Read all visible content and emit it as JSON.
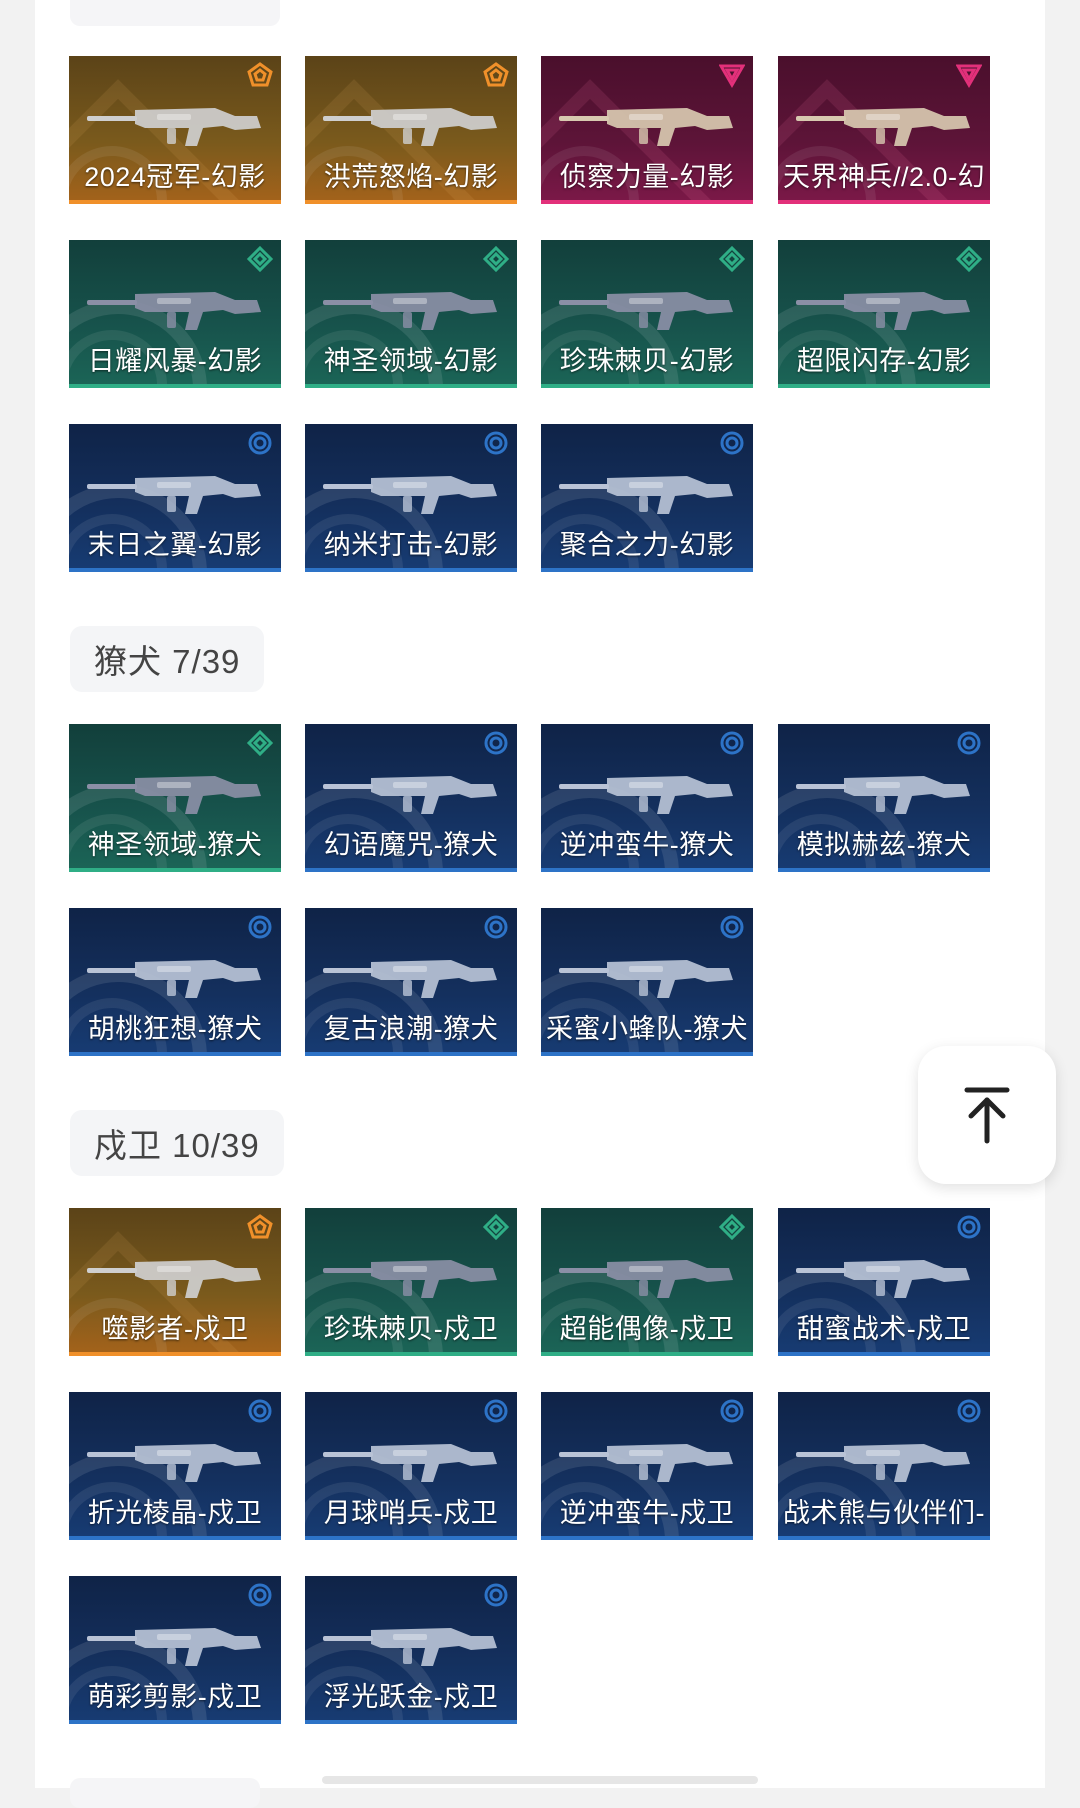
{
  "sections": [
    {
      "title": "",
      "tiles": [
        {
          "name": "2024冠军-幻影",
          "tier": "orange"
        },
        {
          "name": "洪荒怒焰-幻影",
          "tier": "orange"
        },
        {
          "name": "侦察力量-幻影",
          "tier": "pink"
        },
        {
          "name": "天界神兵//2.0-幻",
          "tier": "pink"
        },
        {
          "name": "日耀风暴-幻影",
          "tier": "green"
        },
        {
          "name": "神圣领域-幻影",
          "tier": "green"
        },
        {
          "name": "珍珠棘贝-幻影",
          "tier": "green"
        },
        {
          "name": "超限闪存-幻影",
          "tier": "green"
        },
        {
          "name": "末日之翼-幻影",
          "tier": "blue"
        },
        {
          "name": "纳米打击-幻影",
          "tier": "blue"
        },
        {
          "name": "聚合之力-幻影",
          "tier": "blue"
        }
      ]
    },
    {
      "title": "獠犬 7/39",
      "tiles": [
        {
          "name": "神圣领域-獠犬",
          "tier": "green"
        },
        {
          "name": "幻语魔咒-獠犬",
          "tier": "blue"
        },
        {
          "name": "逆冲蛮牛-獠犬",
          "tier": "blue"
        },
        {
          "name": "模拟赫兹-獠犬",
          "tier": "blue"
        },
        {
          "name": "胡桃狂想-獠犬",
          "tier": "blue"
        },
        {
          "name": "复古浪潮-獠犬",
          "tier": "blue"
        },
        {
          "name": "采蜜小蜂队-獠犬",
          "tier": "blue"
        }
      ]
    },
    {
      "title": "戍卫 10/39",
      "tiles": [
        {
          "name": "噬影者-戍卫",
          "tier": "orange"
        },
        {
          "name": "珍珠棘贝-戍卫",
          "tier": "green"
        },
        {
          "name": "超能偶像-戍卫",
          "tier": "green"
        },
        {
          "name": "甜蜜战术-戍卫",
          "tier": "blue"
        },
        {
          "name": "折光棱晶-戍卫",
          "tier": "blue"
        },
        {
          "name": "月球哨兵-戍卫",
          "tier": "blue"
        },
        {
          "name": "逆冲蛮牛-戍卫",
          "tier": "blue"
        },
        {
          "name": "战术熊与伙伴们-",
          "tier": "blue"
        },
        {
          "name": "萌彩剪影-戍卫",
          "tier": "blue"
        },
        {
          "name": "浮光跃金-戍卫",
          "tier": "blue"
        }
      ]
    }
  ],
  "tier_colors": {
    "orange": "#f0902a",
    "pink": "#e2307a",
    "green": "#2fae86",
    "blue": "#2d73c7"
  },
  "tier_icons": {
    "orange": "pentagon-tier-icon",
    "pink": "triangle-tier-icon",
    "green": "diamond-tier-icon",
    "blue": "circle-tier-icon"
  },
  "scroll_top": {
    "icon": "arrow-up-to-top-icon"
  }
}
